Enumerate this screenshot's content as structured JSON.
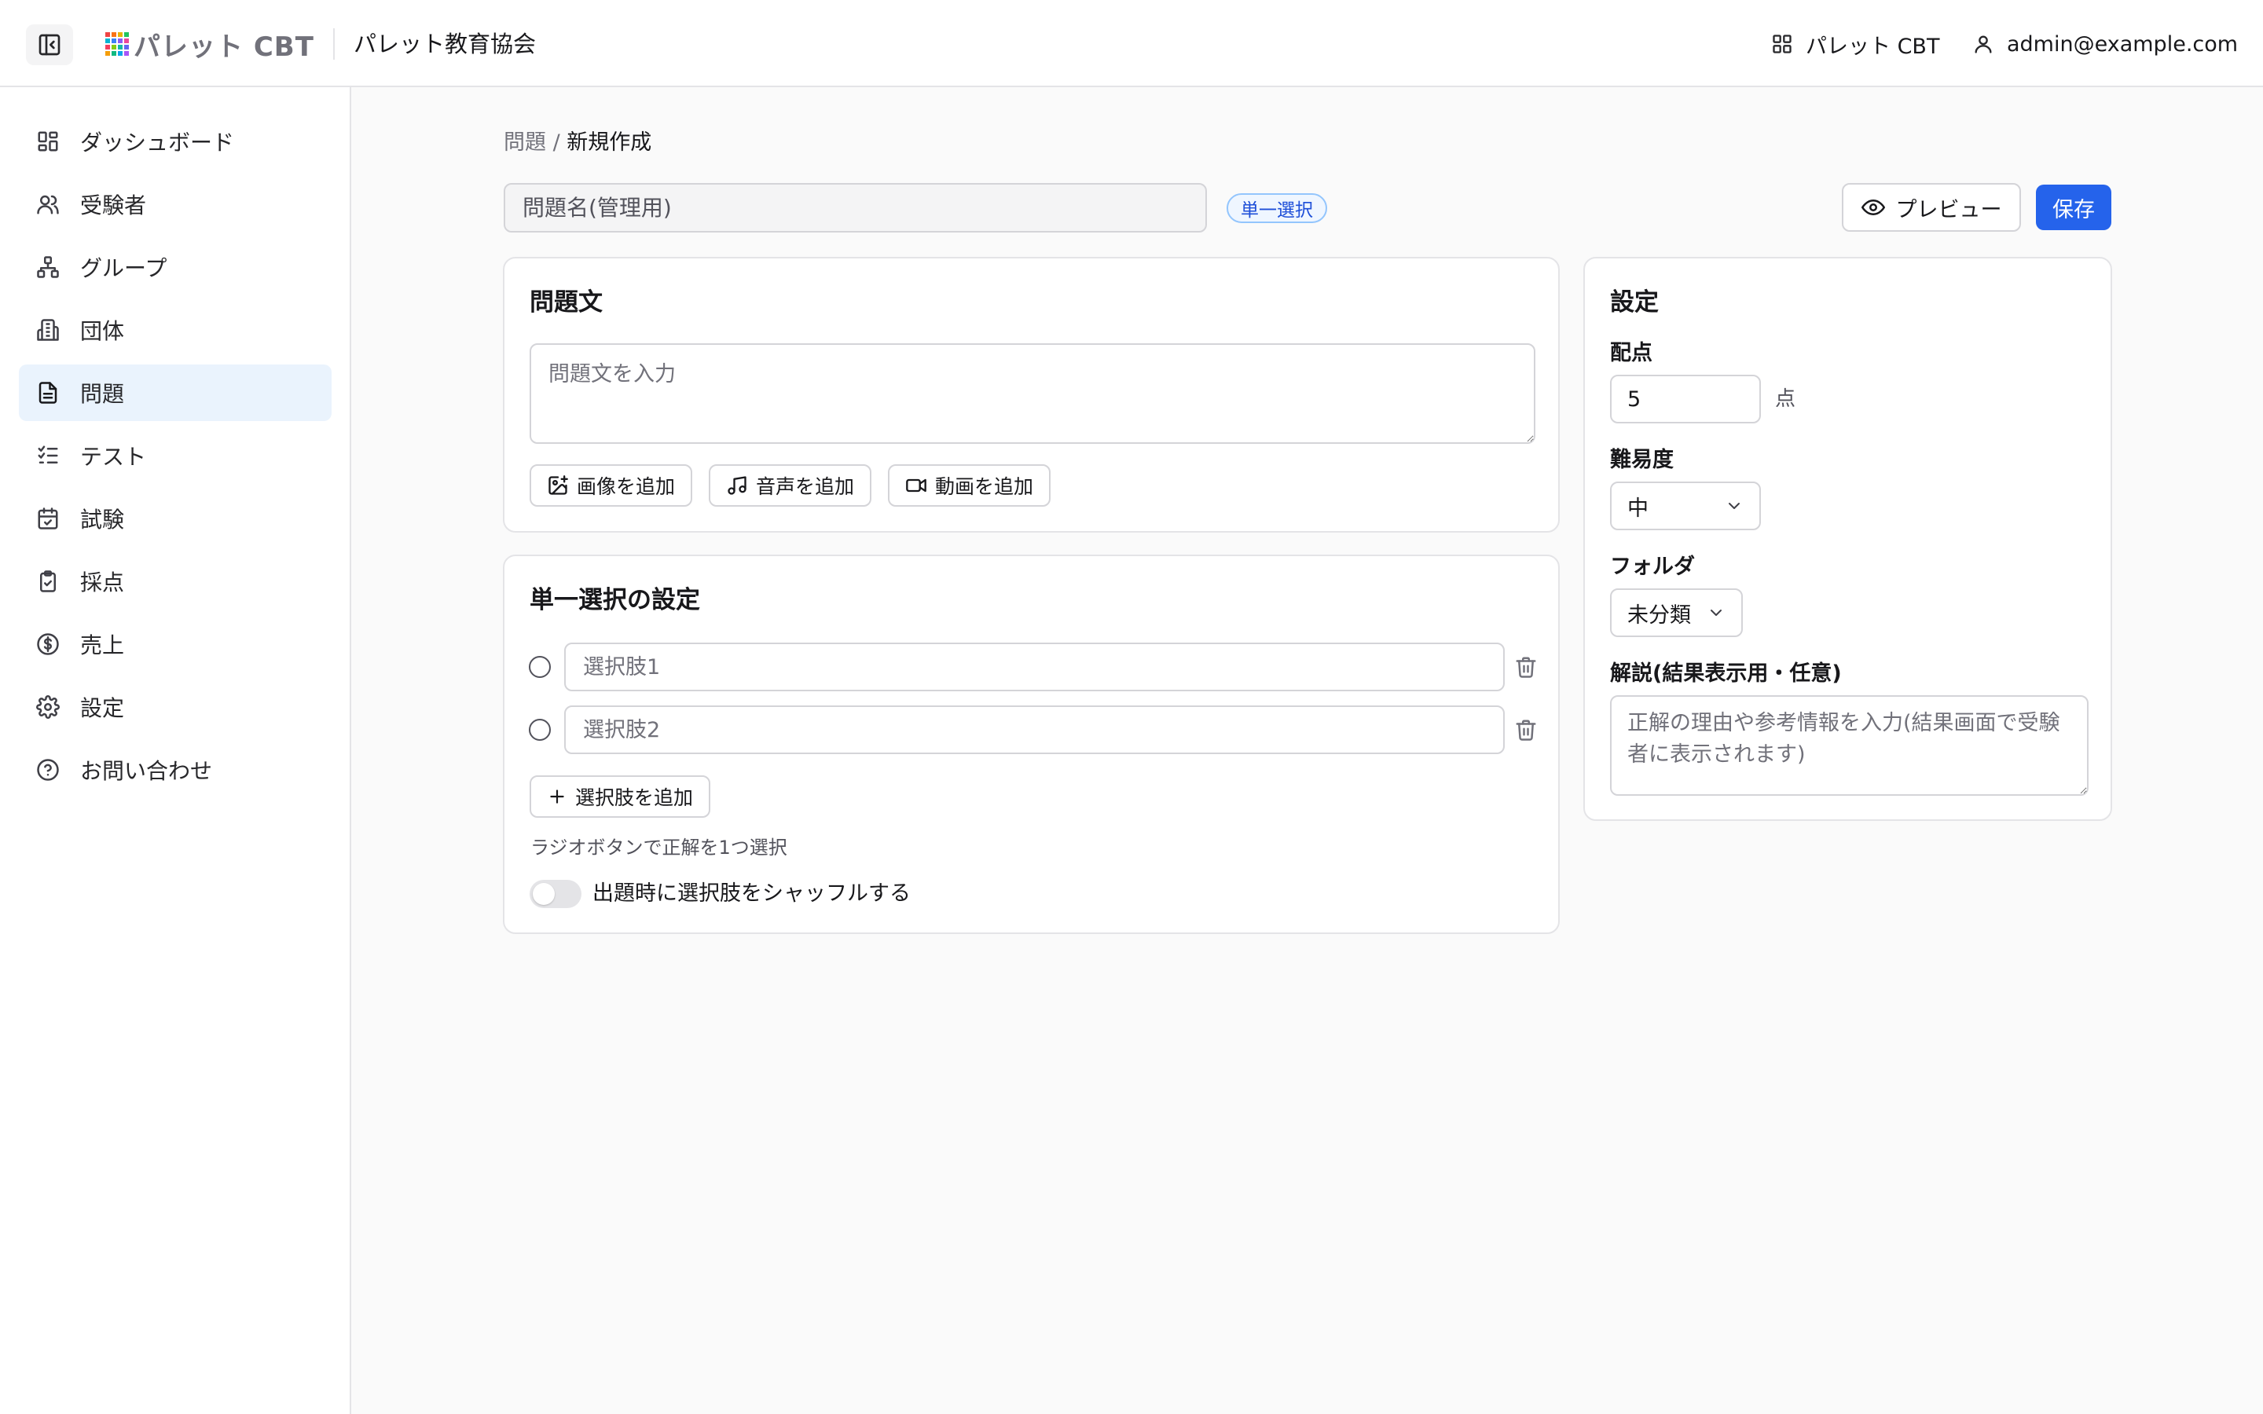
{
  "header": {
    "logo_text": "パレット CBT",
    "org_name": "パレット教育協会",
    "app_link": "パレット CBT",
    "user_email": "admin@example.com"
  },
  "sidebar": {
    "items": [
      {
        "label": "ダッシュボード",
        "icon": "dashboard-icon"
      },
      {
        "label": "受験者",
        "icon": "users-icon"
      },
      {
        "label": "グループ",
        "icon": "network-icon"
      },
      {
        "label": "団体",
        "icon": "building-icon"
      },
      {
        "label": "問題",
        "icon": "document-icon",
        "active": true
      },
      {
        "label": "テスト",
        "icon": "checklist-icon"
      },
      {
        "label": "試験",
        "icon": "calendar-check-icon"
      },
      {
        "label": "採点",
        "icon": "clipboard-check-icon"
      },
      {
        "label": "売上",
        "icon": "dollar-icon"
      },
      {
        "label": "設定",
        "icon": "gear-icon"
      },
      {
        "label": "お問い合わせ",
        "icon": "help-icon"
      }
    ]
  },
  "breadcrumb": {
    "parent": "問題",
    "separator": " / ",
    "current": "新規作成"
  },
  "toolbar": {
    "title_placeholder": "問題名(管理用)",
    "type_badge": "単一選択",
    "preview_label": "プレビュー",
    "save_label": "保存"
  },
  "question": {
    "title": "問題文",
    "placeholder": "問題文を入力",
    "add_image": "画像を追加",
    "add_audio": "音声を追加",
    "add_video": "動画を追加"
  },
  "choices": {
    "title": "単一選択の設定",
    "items": [
      {
        "placeholder": "選択肢1"
      },
      {
        "placeholder": "選択肢2"
      }
    ],
    "add_label": "選択肢を追加",
    "hint": "ラジオボタンで正解を1つ選択",
    "shuffle_label": "出題時に選択肢をシャッフルする"
  },
  "settings": {
    "title": "設定",
    "score_label": "配点",
    "score_value": "5",
    "score_unit": "点",
    "difficulty_label": "難易度",
    "difficulty_value": "中",
    "folder_label": "フォルダ",
    "folder_value": "未分類",
    "explanation_label": "解説(結果表示用・任意)",
    "explanation_placeholder": "正解の理由や参考情報を入力(結果画面で受験者に表示されます)"
  },
  "colors": {
    "accent": "#2563eb",
    "active_bg": "#eaf3fd"
  }
}
